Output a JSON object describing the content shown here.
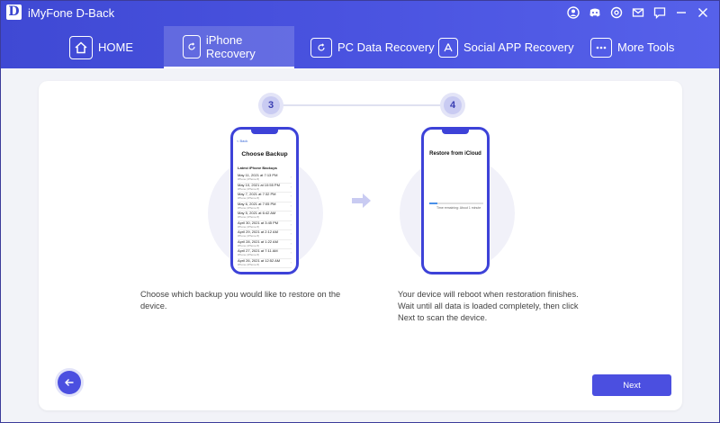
{
  "app": {
    "logo_letter": "D",
    "title": "iMyFone D-Back"
  },
  "titlebar_icons": [
    "user-icon",
    "discord-icon",
    "settings-icon",
    "mail-icon",
    "chat-icon",
    "minimize-icon",
    "close-icon"
  ],
  "tabs": [
    {
      "label": "HOME",
      "icon": "home-icon"
    },
    {
      "label": "iPhone Recovery",
      "icon": "iphone-recovery-icon",
      "active": true
    },
    {
      "label": "PC Data Recovery",
      "icon": "pc-recovery-icon"
    },
    {
      "label": "Social APP Recovery",
      "icon": "app-store-icon"
    },
    {
      "label": "More Tools",
      "icon": "more-tools-icon"
    }
  ],
  "steps": {
    "left": "3",
    "right": "4"
  },
  "phone_left": {
    "back": "< Back",
    "title": "Choose Backup",
    "subtitle": "Latest iPhone Backups",
    "backups": [
      {
        "date": "May 11, 2021 at 7:13 PM",
        "name": "iPhone (iPhone 8)"
      },
      {
        "date": "May 10, 2021 at 10:55 PM",
        "name": "iPhone (iPhone 8)"
      },
      {
        "date": "May 7, 2021 at 7:32 PM",
        "name": "iPhone (iPhone 8)"
      },
      {
        "date": "May 6, 2021 at 7:05 PM",
        "name": "iPhone (iPhone 8)"
      },
      {
        "date": "May 5, 2021 at 6:42 AM",
        "name": "iPhone (iPhone 8)"
      },
      {
        "date": "April 30, 2021 at 3:45 PM",
        "name": "iPhone (iPhone 8)"
      },
      {
        "date": "April 29, 2021 at 2:12 AM",
        "name": "iPhone (iPhone 8)"
      },
      {
        "date": "April 28, 2021 at 1:22 AM",
        "name": "iPhone (iPhone 8)"
      },
      {
        "date": "April 27, 2021 at 7:11 AM",
        "name": "iPhone (iPhone 8)"
      },
      {
        "date": "April 26, 2021 at 12:52 AM",
        "name": "iPhone (iPhone 8)"
      }
    ]
  },
  "phone_right": {
    "title": "Restore from iCloud",
    "progress_text": "Time remaining: About 1 minute",
    "progress": 0.15,
    "progress_color": "#4a90e8"
  },
  "captions": {
    "left": "Choose which backup you would like to restore on the device.",
    "right": "Your device will reboot when restoration finishes. Wait until all data is loaded completely, then click Next to scan the device."
  },
  "buttons": {
    "next": "Next",
    "back_icon": "arrow-left-icon"
  },
  "colors": {
    "accent": "#4b4fe0",
    "header": "#4a53e0"
  }
}
